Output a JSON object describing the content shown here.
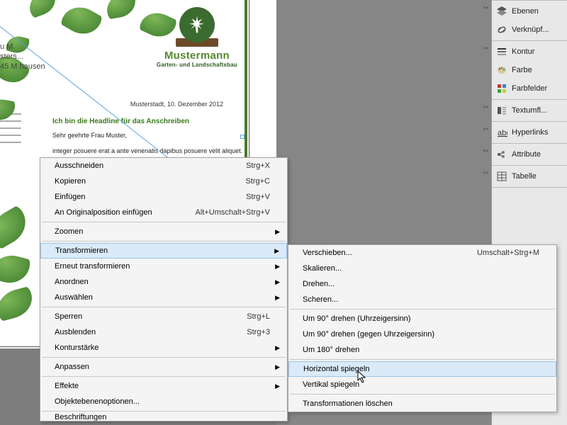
{
  "document": {
    "logo_name": "Mustermann",
    "logo_tag": "Garten- und Landschaftsbau",
    "date": "Musterstadt, 10. Dezember 2012",
    "headline": "Ich bin die Headline für das Anschreiben",
    "salutation": "Sehr geehrte Frau Muster,",
    "body": "integer posuere erat a ante venenatis dapibus posuere velit aliquet.",
    "addr1": "u M",
    "addr2": "sters...",
    "addr3": "45 M   hausen"
  },
  "panels": {
    "ebenen": "Ebenen",
    "verknuepf": "Verknüpf...",
    "kontur": "Kontur",
    "farbe": "Farbe",
    "farbfelder": "Farbfelder",
    "textumfl": "Textumfl...",
    "hyperlinks": "Hyperlinks",
    "attribute": "Attribute",
    "tabelle": "Tabelle"
  },
  "ctx_main": {
    "ausschneiden": "Ausschneiden",
    "ausschneiden_s": "Strg+X",
    "kopieren": "Kopieren",
    "kopieren_s": "Strg+C",
    "einfuegen": "Einfügen",
    "einfuegen_s": "Strg+V",
    "orig": "An Originalposition einfügen",
    "orig_s": "Alt+Umschalt+Strg+V",
    "zoomen": "Zoomen",
    "transformieren": "Transformieren",
    "erneut": "Erneut transformieren",
    "anordnen": "Anordnen",
    "auswaehlen": "Auswählen",
    "sperren": "Sperren",
    "sperren_s": "Strg+L",
    "ausblenden": "Ausblenden",
    "ausblenden_s": "Strg+3",
    "konturstaerke": "Konturstärke",
    "anpassen": "Anpassen",
    "effekte": "Effekte",
    "objektebenen": "Objektebenenoptionen...",
    "cutoff": "Beschriftungen"
  },
  "ctx_sub": {
    "verschieben": "Verschieben...",
    "verschieben_s": "Umschalt+Strg+M",
    "skalieren": "Skalieren...",
    "drehen": "Drehen...",
    "scheren": "Scheren...",
    "d90u": "Um 90° drehen (Uhrzeigersinn)",
    "d90g": "Um 90° drehen (gegen Uhrzeigersinn)",
    "d180": "Um 180° drehen",
    "hsp": "Horizontal spiegeln",
    "vsp": "Vertikal spiegeln",
    "tloeschen": "Transformationen löschen"
  }
}
